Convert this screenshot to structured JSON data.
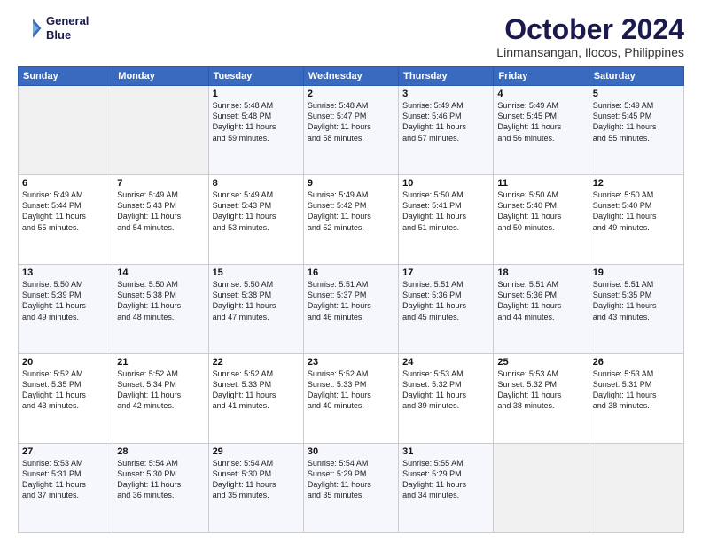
{
  "logo": {
    "line1": "General",
    "line2": "Blue"
  },
  "title": "October 2024",
  "subtitle": "Linmansangan, Ilocos, Philippines",
  "header_days": [
    "Sunday",
    "Monday",
    "Tuesday",
    "Wednesday",
    "Thursday",
    "Friday",
    "Saturday"
  ],
  "weeks": [
    [
      {
        "day": "",
        "content": ""
      },
      {
        "day": "",
        "content": ""
      },
      {
        "day": "1",
        "content": "Sunrise: 5:48 AM\nSunset: 5:48 PM\nDaylight: 11 hours\nand 59 minutes."
      },
      {
        "day": "2",
        "content": "Sunrise: 5:48 AM\nSunset: 5:47 PM\nDaylight: 11 hours\nand 58 minutes."
      },
      {
        "day": "3",
        "content": "Sunrise: 5:49 AM\nSunset: 5:46 PM\nDaylight: 11 hours\nand 57 minutes."
      },
      {
        "day": "4",
        "content": "Sunrise: 5:49 AM\nSunset: 5:45 PM\nDaylight: 11 hours\nand 56 minutes."
      },
      {
        "day": "5",
        "content": "Sunrise: 5:49 AM\nSunset: 5:45 PM\nDaylight: 11 hours\nand 55 minutes."
      }
    ],
    [
      {
        "day": "6",
        "content": "Sunrise: 5:49 AM\nSunset: 5:44 PM\nDaylight: 11 hours\nand 55 minutes."
      },
      {
        "day": "7",
        "content": "Sunrise: 5:49 AM\nSunset: 5:43 PM\nDaylight: 11 hours\nand 54 minutes."
      },
      {
        "day": "8",
        "content": "Sunrise: 5:49 AM\nSunset: 5:43 PM\nDaylight: 11 hours\nand 53 minutes."
      },
      {
        "day": "9",
        "content": "Sunrise: 5:49 AM\nSunset: 5:42 PM\nDaylight: 11 hours\nand 52 minutes."
      },
      {
        "day": "10",
        "content": "Sunrise: 5:50 AM\nSunset: 5:41 PM\nDaylight: 11 hours\nand 51 minutes."
      },
      {
        "day": "11",
        "content": "Sunrise: 5:50 AM\nSunset: 5:40 PM\nDaylight: 11 hours\nand 50 minutes."
      },
      {
        "day": "12",
        "content": "Sunrise: 5:50 AM\nSunset: 5:40 PM\nDaylight: 11 hours\nand 49 minutes."
      }
    ],
    [
      {
        "day": "13",
        "content": "Sunrise: 5:50 AM\nSunset: 5:39 PM\nDaylight: 11 hours\nand 49 minutes."
      },
      {
        "day": "14",
        "content": "Sunrise: 5:50 AM\nSunset: 5:38 PM\nDaylight: 11 hours\nand 48 minutes."
      },
      {
        "day": "15",
        "content": "Sunrise: 5:50 AM\nSunset: 5:38 PM\nDaylight: 11 hours\nand 47 minutes."
      },
      {
        "day": "16",
        "content": "Sunrise: 5:51 AM\nSunset: 5:37 PM\nDaylight: 11 hours\nand 46 minutes."
      },
      {
        "day": "17",
        "content": "Sunrise: 5:51 AM\nSunset: 5:36 PM\nDaylight: 11 hours\nand 45 minutes."
      },
      {
        "day": "18",
        "content": "Sunrise: 5:51 AM\nSunset: 5:36 PM\nDaylight: 11 hours\nand 44 minutes."
      },
      {
        "day": "19",
        "content": "Sunrise: 5:51 AM\nSunset: 5:35 PM\nDaylight: 11 hours\nand 43 minutes."
      }
    ],
    [
      {
        "day": "20",
        "content": "Sunrise: 5:52 AM\nSunset: 5:35 PM\nDaylight: 11 hours\nand 43 minutes."
      },
      {
        "day": "21",
        "content": "Sunrise: 5:52 AM\nSunset: 5:34 PM\nDaylight: 11 hours\nand 42 minutes."
      },
      {
        "day": "22",
        "content": "Sunrise: 5:52 AM\nSunset: 5:33 PM\nDaylight: 11 hours\nand 41 minutes."
      },
      {
        "day": "23",
        "content": "Sunrise: 5:52 AM\nSunset: 5:33 PM\nDaylight: 11 hours\nand 40 minutes."
      },
      {
        "day": "24",
        "content": "Sunrise: 5:53 AM\nSunset: 5:32 PM\nDaylight: 11 hours\nand 39 minutes."
      },
      {
        "day": "25",
        "content": "Sunrise: 5:53 AM\nSunset: 5:32 PM\nDaylight: 11 hours\nand 38 minutes."
      },
      {
        "day": "26",
        "content": "Sunrise: 5:53 AM\nSunset: 5:31 PM\nDaylight: 11 hours\nand 38 minutes."
      }
    ],
    [
      {
        "day": "27",
        "content": "Sunrise: 5:53 AM\nSunset: 5:31 PM\nDaylight: 11 hours\nand 37 minutes."
      },
      {
        "day": "28",
        "content": "Sunrise: 5:54 AM\nSunset: 5:30 PM\nDaylight: 11 hours\nand 36 minutes."
      },
      {
        "day": "29",
        "content": "Sunrise: 5:54 AM\nSunset: 5:30 PM\nDaylight: 11 hours\nand 35 minutes."
      },
      {
        "day": "30",
        "content": "Sunrise: 5:54 AM\nSunset: 5:29 PM\nDaylight: 11 hours\nand 35 minutes."
      },
      {
        "day": "31",
        "content": "Sunrise: 5:55 AM\nSunset: 5:29 PM\nDaylight: 11 hours\nand 34 minutes."
      },
      {
        "day": "",
        "content": ""
      },
      {
        "day": "",
        "content": ""
      }
    ]
  ]
}
